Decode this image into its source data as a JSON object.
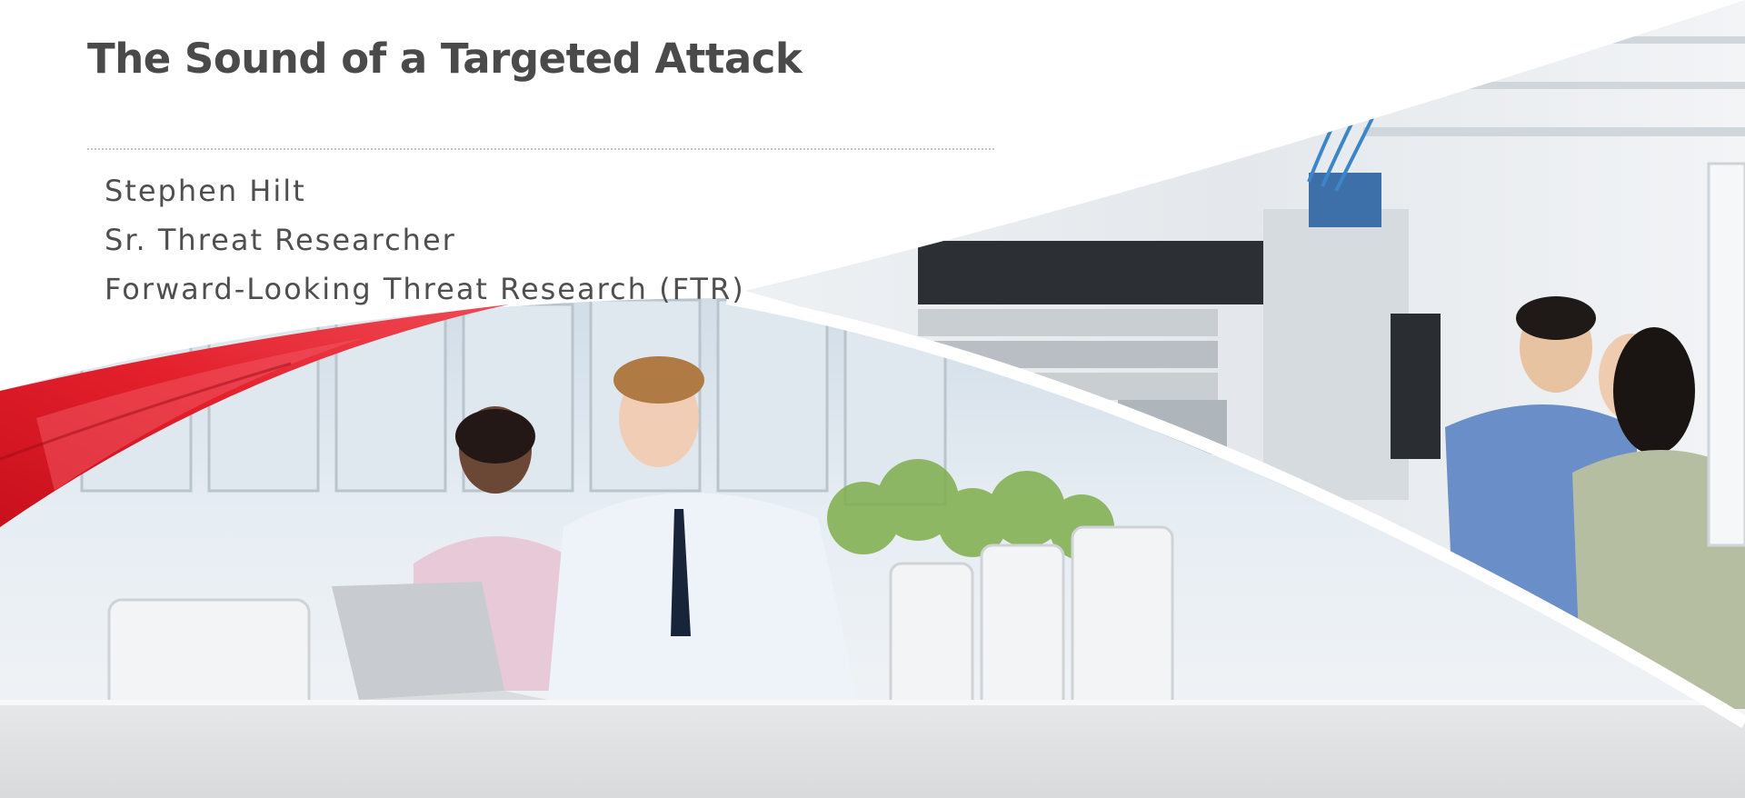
{
  "slide": {
    "title": "The Sound of a Targeted Attack",
    "presenter": {
      "name": "Stephen Hilt",
      "role": "Sr. Threat Researcher",
      "team": "Forward-Looking Threat Research (FTR)"
    }
  },
  "theme": {
    "accent": "#e0202b",
    "accent_dark": "#b8101b",
    "text": "#4a4a4a",
    "divider": "#c4c4c4"
  },
  "images": {
    "left_photo": "office-meeting-photo",
    "right_photo": "server-room-photo"
  }
}
